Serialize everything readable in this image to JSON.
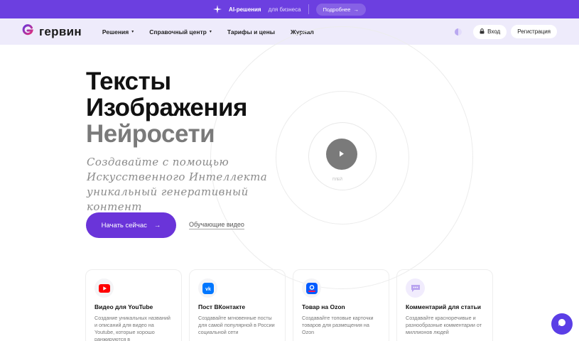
{
  "promo": {
    "title": "AI-решения",
    "sub": "для бизнеса",
    "more": "Подробнее",
    "more_arrow": "→"
  },
  "nav": {
    "logo": "гервин",
    "menu": [
      {
        "label": "Решения",
        "chevron": "▾"
      },
      {
        "label": "Справочный центр",
        "chevron": "▾"
      },
      {
        "label": "Тарифы и цены"
      },
      {
        "label": "Журнал"
      }
    ],
    "login": "Вход",
    "register": "Регистрация"
  },
  "hero": {
    "line1": "Тексты",
    "line2": "Изображения",
    "line3": "Нейросети",
    "subtitle": "Создавайте с помощью Искусственного Интеллекта уникальный генеративный контент",
    "cta": "Начать сейчас",
    "cta_arrow": "→",
    "video_link": "Обучающие видео",
    "play_label": "ПЛЕЙ"
  },
  "cards": [
    {
      "icon": "youtube-icon",
      "title": "Видео для YouTube",
      "desc": "Создание уникальных названий и описаний для видео на Youtube, которые хорошо ранжируются в"
    },
    {
      "icon": "vk-icon",
      "title": "Пост ВКонтакте",
      "desc": "Создавайте мгновенные посты для самой популярной в России социальной сети"
    },
    {
      "icon": "ozon-icon",
      "title": "Товар на Ozon",
      "desc": "Создавайте топовые карточки товаров для размещения на Ozon"
    },
    {
      "icon": "comment-icon",
      "title": "Комментарий для статьи",
      "desc": "Создавайте красноречивые и разнообразные комментарии от миллионов людей"
    }
  ],
  "colors": {
    "accent": "#6a34d9",
    "promo_bg": "#6c3fe0",
    "nav_bg": "#eeebfb",
    "youtube": "#ff0000",
    "vk": "#0077ff",
    "ozon": "#005bff"
  }
}
